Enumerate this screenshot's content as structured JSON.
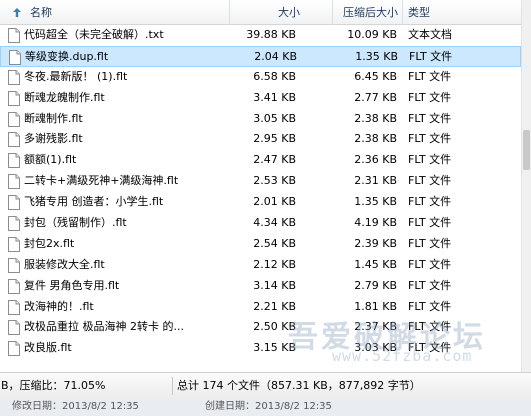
{
  "columns": {
    "name": "名称",
    "size": "大小",
    "packed": "压缩后大小",
    "type": "类型"
  },
  "files": [
    {
      "name": "代码超全（未完全破解）.txt",
      "size": "39.88 KB",
      "packed": "10.09 KB",
      "type": "文本文档"
    },
    {
      "name": "等级变换.dup.flt",
      "size": "2.04 KB",
      "packed": "1.35 KB",
      "type": "FLT 文件"
    },
    {
      "name": "冬夜.最新版！ (1).flt",
      "size": "6.58 KB",
      "packed": "6.45 KB",
      "type": "FLT 文件"
    },
    {
      "name": "断魂龙魄制作.flt",
      "size": "3.41 KB",
      "packed": "2.77 KB",
      "type": "FLT 文件"
    },
    {
      "name": "断魂制作.flt",
      "size": "3.05 KB",
      "packed": "2.38 KB",
      "type": "FLT 文件"
    },
    {
      "name": "多谢残影.flt",
      "size": "2.95 KB",
      "packed": "2.38 KB",
      "type": "FLT 文件"
    },
    {
      "name": "额额(1).flt",
      "size": "2.47 KB",
      "packed": "2.36 KB",
      "type": "FLT 文件"
    },
    {
      "name": "二转卡+满级死神+满级海神.flt",
      "size": "2.53 KB",
      "packed": "2.31 KB",
      "type": "FLT 文件"
    },
    {
      "name": "飞猪专用 创造者：小学生.flt",
      "size": "2.01 KB",
      "packed": "1.35 KB",
      "type": "FLT 文件"
    },
    {
      "name": "封包（残留制作）.flt",
      "size": "4.34 KB",
      "packed": "4.19 KB",
      "type": "FLT 文件"
    },
    {
      "name": "封包2x.flt",
      "size": "2.54 KB",
      "packed": "2.39 KB",
      "type": "FLT 文件"
    },
    {
      "name": "服装修改大全.flt",
      "size": "2.12 KB",
      "packed": "1.45 KB",
      "type": "FLT 文件"
    },
    {
      "name": "复件 男角色专用.flt",
      "size": "3.14 KB",
      "packed": "2.79 KB",
      "type": "FLT 文件"
    },
    {
      "name": "改海神的！.flt",
      "size": "2.21 KB",
      "packed": "1.81 KB",
      "type": "FLT 文件"
    },
    {
      "name": "改极品重拉 极品海神 2转卡 的...",
      "size": "2.50 KB",
      "packed": "2.37 KB",
      "type": "FLT 文件"
    },
    {
      "name": "改良版.flt",
      "size": "3.15 KB",
      "packed": "3.03 KB",
      "type": "FLT 文件"
    }
  ],
  "selected_index": 1,
  "status": {
    "left": "B，压缩比：71.05%",
    "right": "总计 174 个文件（857.31 KB，877,892 字节）"
  },
  "info": {
    "modified": "修改日期：2013/8/2 12:35",
    "created": "创建日期：2013/8/2 12:35"
  },
  "watermark": {
    "text": "吾爱破解论坛",
    "url": "www.52fzba.com"
  },
  "icons": {
    "sort": "sort-up-arrow-icon",
    "file": "document-file-icon"
  },
  "colors": {
    "selection_bg": "#cce8ff",
    "selection_border": "#99d1ff",
    "header_text": "#1e395b",
    "sort_arrow": "#3c7fb1"
  }
}
